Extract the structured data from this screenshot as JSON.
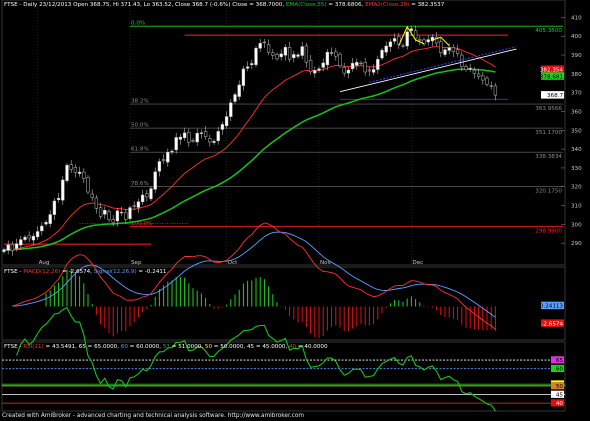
{
  "footer": "Created with AmiBroker - advanced charting and technical analysis software. http://www.amibroker.com",
  "chart_data": [
    {
      "type": "candlestick",
      "title_parts": [
        {
          "text": "FTSE - Daily 23/12/2013 Open 368.75, Hi 371.43, Lo 363.52, Close 368.7 (-0.6%)  Close = 368.7000, ",
          "color": "#ffffff"
        },
        {
          "text": "EMA(Close,55)",
          "color": "#19c219"
        },
        {
          "text": " = 378.6806, ",
          "color": "#ffffff"
        },
        {
          "text": "EMA2(Close,20)",
          "color": "#ff3030"
        },
        {
          "text": " = 382.3537",
          "color": "#ffffff"
        }
      ],
      "ylim": [
        280,
        415
      ],
      "y_ticks": [
        290,
        300,
        310,
        320,
        330,
        340,
        350,
        360,
        370,
        380,
        390,
        400,
        410
      ],
      "x_ticks": [
        "Aug",
        "Sep",
        "Oct",
        "Nov",
        "Dec"
      ],
      "x_tick_index": [
        8,
        30,
        53,
        75,
        97
      ],
      "fib_levels": [
        {
          "label": "0.0%",
          "value": "405.3500",
          "color": "#1fd11f"
        },
        {
          "label": "38.2%",
          "value": "363.9566",
          "color": "#8c8c8c"
        },
        {
          "label": "50.0%",
          "value": "351.1700",
          "color": "#8c8c8c"
        },
        {
          "label": "61.8%",
          "value": "338.3834",
          "color": "#8c8c8c"
        },
        {
          "label": "78.6%",
          "value": "320.1750",
          "color": "#8c8c8c"
        },
        {
          "label": "100.0%",
          "value": "298.9900",
          "color": "#ff2020"
        }
      ],
      "fib_values": [
        405.35,
        363.9566,
        351.17,
        338.3834,
        320.175,
        298.99
      ],
      "value_tags": [
        {
          "text": "382.354",
          "value": 382.354,
          "bg": "#e01010",
          "fg": "#ffffff"
        },
        {
          "text": "378.681",
          "value": 378.681,
          "bg": "#1fd11f",
          "fg": "#000000"
        },
        {
          "text": "368.7",
          "value": 368.7,
          "bg": "#ffffff",
          "fg": "#000000"
        }
      ],
      "red_resistance_lines": [
        {
          "from": 0,
          "to": 35,
          "value": 289.5
        },
        {
          "from": 43,
          "to": 120,
          "value": 400.6
        }
      ],
      "trendline_black_support": {
        "from": [
          80,
          370.5
        ],
        "to": [
          122,
          393.2
        ]
      },
      "trendline_blue_dashed": {
        "from": [
          87,
          375.5
        ],
        "to": [
          122,
          394.5
        ]
      },
      "blue_horizontal": {
        "from": 80,
        "to": 120,
        "value": 366.5
      },
      "bar_count": 118,
      "close": [
        286.5,
        289.1,
        286.1,
        289.7,
        291.9,
        293.2,
        292.7,
        293.7,
        296.2,
        299.1,
        301.1,
        305.2,
        312.4,
        313.9,
        323.6,
        331.4,
        329.3,
        327.7,
        327.8,
        324.3,
        317.2,
        314.4,
        308.5,
        304.3,
        307.5,
        302.5,
        301.1,
        307.2,
        306.5,
        302.7,
        308.9,
        309.7,
        312.0,
        315.6,
        314.6,
        319.0,
        327.9,
        333.4,
        333.8,
        338.3,
        338.9,
        346.2,
        346.4,
        348.6,
        343.6,
        344.5,
        348.4,
        348.7,
        346.6,
        343.8,
        344.1,
        349.4,
        353.1,
        357.3,
        364.6,
        369.0,
        374.1,
        382.6,
        383.8,
        385.5,
        393.6,
        396.2,
        396.5,
        391.5,
        389.9,
        388.0,
        390.6,
        394.1,
        387.8,
        390.3,
        390.1,
        394.5,
        386.2,
        381.1,
        381.8,
        382.7,
        385.8,
        391.5,
        391.3,
        389.4,
        384.2,
        380.4,
        382.0,
        385.6,
        386.1,
        385.7,
        381.0,
        381.5,
        382.3,
        387.7,
        392.6,
        394.8,
        397.0,
        398.8,
        395.7,
        394.8,
        402.3,
        404.0,
        398.6,
        397.7,
        395.9,
        398.2,
        399.5,
        396.4,
        391.3,
        392.8,
        393.8,
        391.7,
        390.7,
        383.9,
        382.2,
        383.0,
        380.3,
        378.6,
        376.7,
        374.4,
        373.6,
        368.7
      ],
      "series": [
        {
          "name": "EMA(Close,55)",
          "color": "#19c219",
          "last": 378.6806
        },
        {
          "name": "EMA2(Close,20)",
          "color": "#ff3030",
          "last": 382.3537
        }
      ]
    },
    {
      "type": "line",
      "title_parts": [
        {
          "text": "FTSE - ",
          "color": "#ffffff"
        },
        {
          "text": "MACD(12,26)",
          "color": "#ff3030"
        },
        {
          "text": " = -2.6574, ",
          "color": "#ffffff"
        },
        {
          "text": "Signal(12,26,9)",
          "color": "#5aa0ff"
        },
        {
          "text": " = -0.2411",
          "color": "#ffffff"
        }
      ],
      "ylim": [
        -6.5,
        6.5
      ],
      "series": [
        {
          "name": "MACD(12,26)",
          "color": "#ff3030",
          "last": -2.6574
        },
        {
          "name": "Signal(12,26,9)",
          "color": "#5aa0ff",
          "last": -0.2411
        }
      ],
      "value_tags": [
        {
          "text": "-0.24113",
          "value": -0.24113,
          "bg": "#5aa0ff",
          "fg": "#000000"
        },
        {
          "text": "-2.6574",
          "value": -2.6574,
          "bg": "#e01010",
          "fg": "#ffffff"
        }
      ]
    },
    {
      "type": "line",
      "title_parts": [
        {
          "text": "FTSE - ",
          "color": "#ffffff"
        },
        {
          "text": "RSI(21)",
          "color": "#ff3030"
        },
        {
          "text": " = 43.5491, ",
          "color": "#ffffff"
        },
        {
          "text": "65",
          "color": "#ffffff"
        },
        {
          "text": " = 65.0000, ",
          "color": "#ffffff"
        },
        {
          "text": "60",
          "color": "#5aa0ff"
        },
        {
          "text": " = 60.0000, ",
          "color": "#ffffff"
        },
        {
          "text": "51",
          "color": "#19c219"
        },
        {
          "text": " = 51.0000, ",
          "color": "#ffffff"
        },
        {
          "text": "50",
          "color": "#ffff00"
        },
        {
          "text": " = 50.0000, ",
          "color": "#ffffff"
        },
        {
          "text": "45",
          "color": "#ffffff"
        },
        {
          "text": " = 45.0000, ",
          "color": "#ffffff"
        },
        {
          "text": "40",
          "color": "#ff3030"
        },
        {
          "text": " = 40.0000",
          "color": "#ffffff"
        }
      ],
      "ylim": [
        36,
        72
      ],
      "levels": [
        {
          "value": 65,
          "color": "#ffffff",
          "dashed": true
        },
        {
          "value": 60,
          "color": "#5aa0ff",
          "dashed": true
        },
        {
          "value": 51,
          "color": "#19c219",
          "dashed": false
        },
        {
          "value": 50,
          "color": "#ffff00",
          "dashed": false
        },
        {
          "value": 45,
          "color": "#ffffff",
          "dashed": false
        },
        {
          "value": 40,
          "color": "#ff3030",
          "dashed": false
        }
      ],
      "value_tags": [
        {
          "text": "65",
          "value": 65,
          "bg": "#e030e0",
          "fg": "#000000"
        },
        {
          "text": "60",
          "value": 60,
          "bg": "#1fd11f",
          "fg": "#000000"
        },
        {
          "text": "51",
          "value": 51,
          "bg": "#ffff00",
          "fg": "#000000"
        },
        {
          "text": "50",
          "value": 50,
          "bg": "#e08020",
          "fg": "#000000"
        },
        {
          "text": "45",
          "value": 45,
          "bg": "#ffffff",
          "fg": "#000000"
        },
        {
          "text": "40",
          "value": 40,
          "bg": "#e01010",
          "fg": "#ffffff"
        }
      ],
      "series": [
        {
          "name": "RSI(21)",
          "color": "#19c219",
          "last": 43.5491
        }
      ]
    }
  ]
}
